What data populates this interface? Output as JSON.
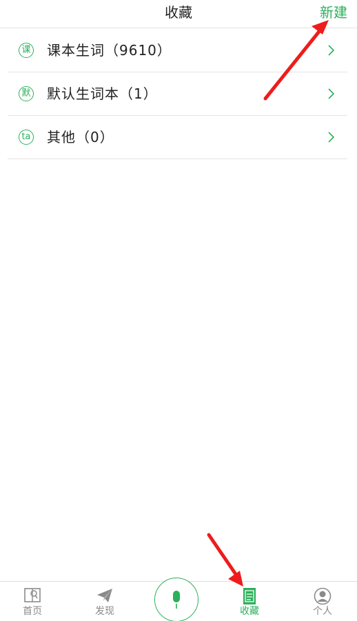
{
  "header": {
    "title": "收藏",
    "new_label": "新建"
  },
  "list": {
    "items": [
      {
        "icon_char": "课",
        "icon": "ke-circle-icon",
        "label": "课本生词（9610）"
      },
      {
        "icon_char": "默",
        "icon": "mo-circle-icon",
        "label": "默认生词本（1）"
      },
      {
        "icon_char": "ta",
        "icon": "ta-circle-icon",
        "label": "其他（0）"
      }
    ]
  },
  "tabbar": {
    "items": [
      {
        "label": "首页",
        "icon": "home-book-icon",
        "active": false
      },
      {
        "label": "发现",
        "icon": "paper-plane-icon",
        "active": false
      },
      {
        "label": "",
        "icon": "microphone-icon",
        "active": false
      },
      {
        "label": "收藏",
        "icon": "bookmark-notebook-icon",
        "active": true
      },
      {
        "label": "个人",
        "icon": "user-avatar-icon",
        "active": false
      }
    ]
  },
  "colors": {
    "accent": "#2bb05b",
    "annotation_arrow": "#ee1c1c",
    "text": "#222222",
    "muted": "#8a8a8a"
  }
}
